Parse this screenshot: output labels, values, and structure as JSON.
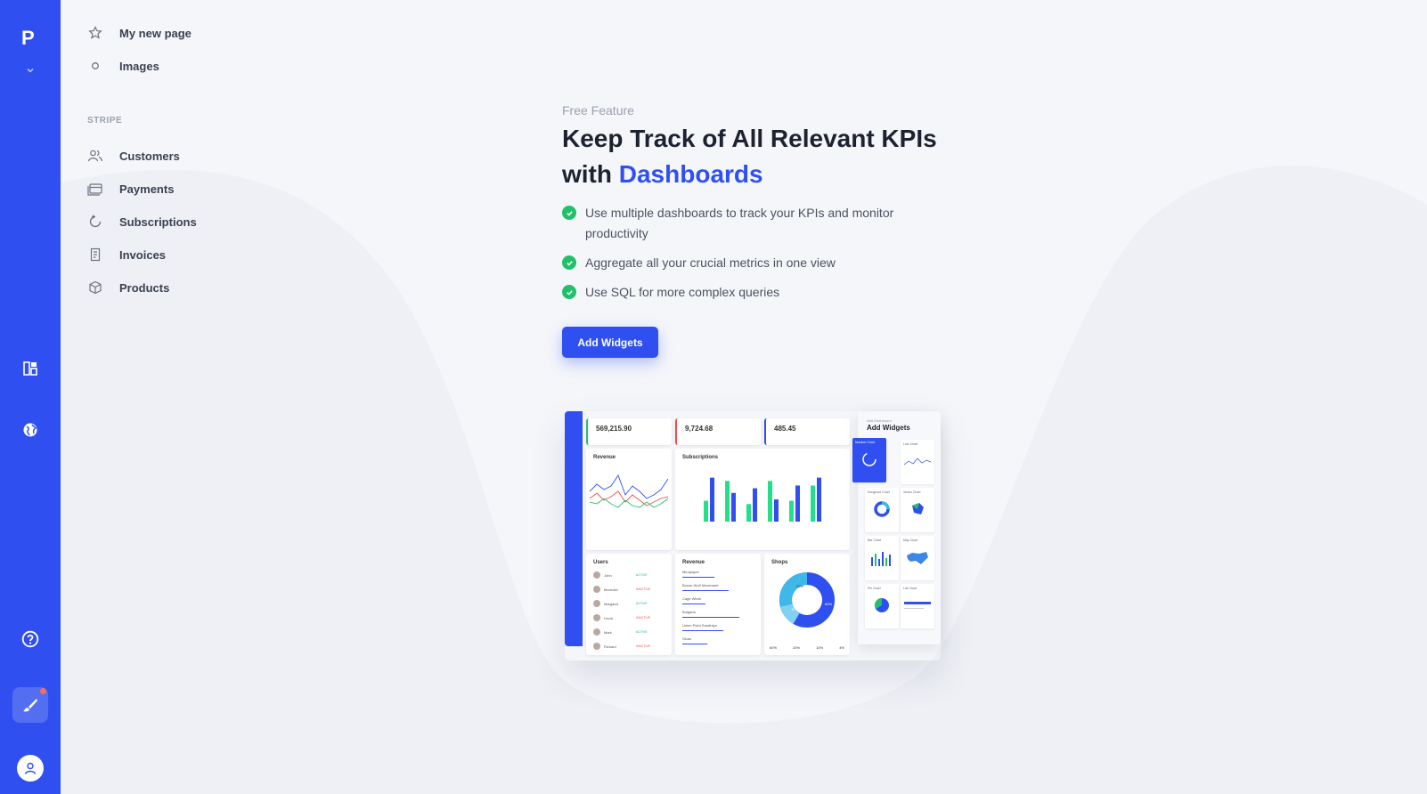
{
  "rail": {
    "logo": "P",
    "icons": [
      "chevron-down-icon",
      "dashboard-icon",
      "globe-icon",
      "help-icon",
      "paintbrush-icon",
      "user-icon"
    ],
    "accent": "#2f4ff0",
    "notification_color": "#ff6b5b"
  },
  "nav": {
    "pages": [
      {
        "label": "My new page",
        "icon": "star-icon"
      },
      {
        "label": "Images",
        "icon": "circle-icon"
      }
    ],
    "section_label": "STRIPE",
    "stripe_items": [
      {
        "label": "Customers",
        "icon": "users-icon"
      },
      {
        "label": "Payments",
        "icon": "wallet-icon"
      },
      {
        "label": "Subscriptions",
        "icon": "refresh-icon"
      },
      {
        "label": "Invoices",
        "icon": "invoice-icon"
      },
      {
        "label": "Products",
        "icon": "box-icon"
      }
    ]
  },
  "hero": {
    "eyebrow": "Free Feature",
    "title_line1": "Keep Track of All Relevant KPIs",
    "title_line2_prefix": "with ",
    "title_accent": "Dashboards",
    "bullets": [
      "Use multiple dashboards to track your KPIs and monitor productivity",
      "Aggregate all your crucial metrics in one view",
      "Use SQL for more complex queries"
    ],
    "cta_label": "Add Widgets",
    "check_color": "#22c06b"
  },
  "preview": {
    "kpis": [
      {
        "value": "569,215.90",
        "color": "#22c06b"
      },
      {
        "value": "9,724.68",
        "color": "#ef4e4e"
      },
      {
        "value": "485.45",
        "color": "#2f4ff0"
      }
    ],
    "revenue_title": "Revenue",
    "subscriptions_title": "Subscriptions",
    "users_title": "Users",
    "revenue_list_title": "Revenue",
    "shops_title": "Shops",
    "shops_segments": [
      "20%",
      "60%",
      "10%"
    ],
    "shops_footer": [
      "60%",
      "20%",
      "10%",
      "4%"
    ],
    "users": [
      {
        "name": "John",
        "status": "ACTIVE",
        "ok": true
      },
      {
        "name": "Benedict",
        "status": "INACTIVE",
        "ok": false
      },
      {
        "name": "Margaret",
        "status": "ACTIVE",
        "ok": true
      },
      {
        "name": "Linda",
        "status": "INACTIVE",
        "ok": false
      },
      {
        "name": "Mark",
        "status": "ACTIVE",
        "ok": true
      },
      {
        "name": "Richard",
        "status": "INACTIVE",
        "ok": false
      }
    ],
    "revenue_items": [
      "Mindpaper",
      "Brown-Wolf Movement",
      "Cage Wirde",
      "Bulgaria",
      "Union Point Sarathiya",
      "Sloan"
    ],
    "sub_bars_blue": [
      0.95,
      0.62,
      0.72,
      0.48,
      0.78,
      0.95
    ],
    "sub_bars_green": [
      0.45,
      0.88,
      0.38,
      0.88,
      0.45,
      0.78
    ],
    "add_widgets_eyebrow": "Add Dashboard",
    "add_widgets_title": "Add Widgets",
    "tiles": [
      "Number Chart",
      "Line Chart",
      "Doughnut Chart",
      "Vector Chart",
      "Bar Chart",
      "Map Chart",
      "Pie Chart",
      "List Chart"
    ]
  }
}
